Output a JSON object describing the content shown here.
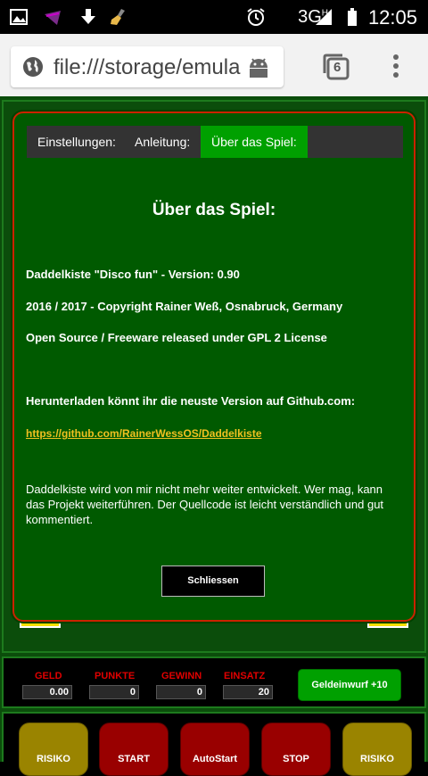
{
  "statusbar": {
    "network": "3G",
    "network_sup": "H",
    "time": "12:05",
    "icons": [
      "image-icon",
      "media-icon",
      "download-icon",
      "broom-icon",
      "alarm-icon",
      "signal-icon",
      "battery-icon"
    ]
  },
  "browser": {
    "url": "file:///storage/emula",
    "tab_count": "6"
  },
  "dialog": {
    "tabs": [
      {
        "label": "Einstellungen:",
        "active": false
      },
      {
        "label": "Anleitung:",
        "active": false
      },
      {
        "label": "Über das Spiel:",
        "active": true
      }
    ],
    "title": "Über das Spiel:",
    "line1": "Daddelkiste \"Disco fun\" - Version: 0.90",
    "line2": "2016 / 2017 - Copyright Rainer Weß, Osnabruck, Germany",
    "line3": "Open Source / Freeware released under GPL 2 License",
    "download_text": "Herunterladen könnt ihr die neuste Version auf Github.com:",
    "link": "https://github.com/RainerWessOS/Daddelkiste",
    "paragraph": "Daddelkiste wird von mir nicht mehr weiter entwickelt. Wer mag, kann das Projekt weiterführen. Der Quellcode ist leicht verständlich und gut kommentiert.",
    "close_label": "Schliessen"
  },
  "panel": {
    "labels": [
      "GELD",
      "PUNKTE",
      "GEWINN",
      "EINSATZ"
    ],
    "values": [
      "0.00",
      "0",
      "0",
      "20"
    ],
    "coin_button": "Geldeinwurf +10"
  },
  "buttons": [
    "RISIKO",
    "START",
    "AutoStart",
    "STOP",
    "RISIKO"
  ],
  "colors": {
    "dialog_bg": "#005a00",
    "dialog_border": "#cc2200",
    "active_tab": "#00a000",
    "link": "#f0c020",
    "label_red": "#e00000"
  }
}
